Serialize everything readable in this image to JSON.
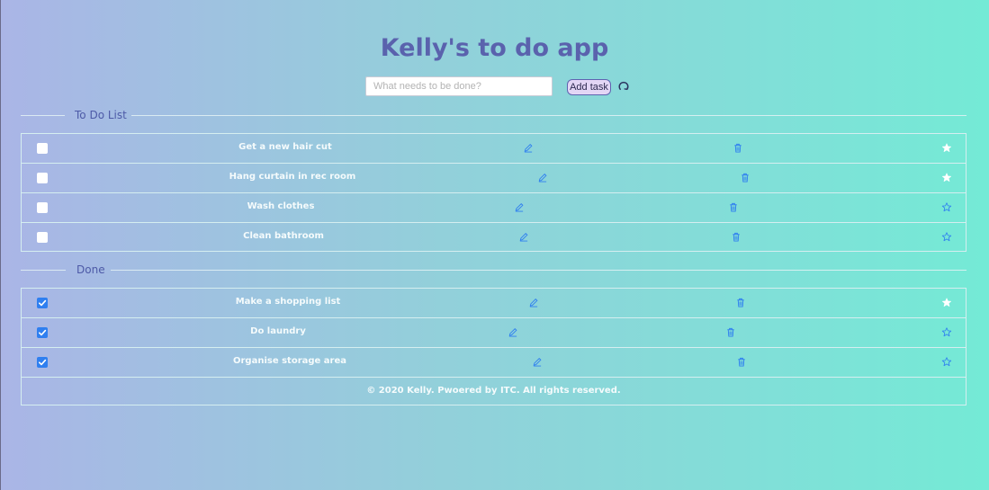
{
  "app": {
    "title": "Kelly's to do app"
  },
  "add_form": {
    "placeholder": "What needs to be done?",
    "value": "",
    "button_label": "Add task"
  },
  "todo": {
    "heading": "To Do List",
    "items": [
      {
        "text": "Get a new hair cut",
        "checked": false,
        "starred": true
      },
      {
        "text": "Hang curtain in rec room",
        "checked": false,
        "starred": true
      },
      {
        "text": "Wash clothes",
        "checked": false,
        "starred": false
      },
      {
        "text": "Clean bathroom",
        "checked": false,
        "starred": false
      }
    ]
  },
  "done": {
    "heading": "Done",
    "items": [
      {
        "text": "Make a shopping list",
        "checked": true,
        "starred": true
      },
      {
        "text": "Do laundry",
        "checked": true,
        "starred": false
      },
      {
        "text": "Organise storage area",
        "checked": true,
        "starred": false
      }
    ]
  },
  "footer": {
    "text": "© 2020 Kelly. Pwoered by ITC. All rights reserved."
  },
  "icons": {
    "refresh": "refresh-icon",
    "edit": "pencil-icon",
    "delete": "trash-icon",
    "star": "star-icon"
  },
  "colors": {
    "title": "#5a62ad",
    "checkbox_checked": "#2f7ff0",
    "icon_blue": "#2f7ff0",
    "button_bg": "#e3d6f5"
  }
}
